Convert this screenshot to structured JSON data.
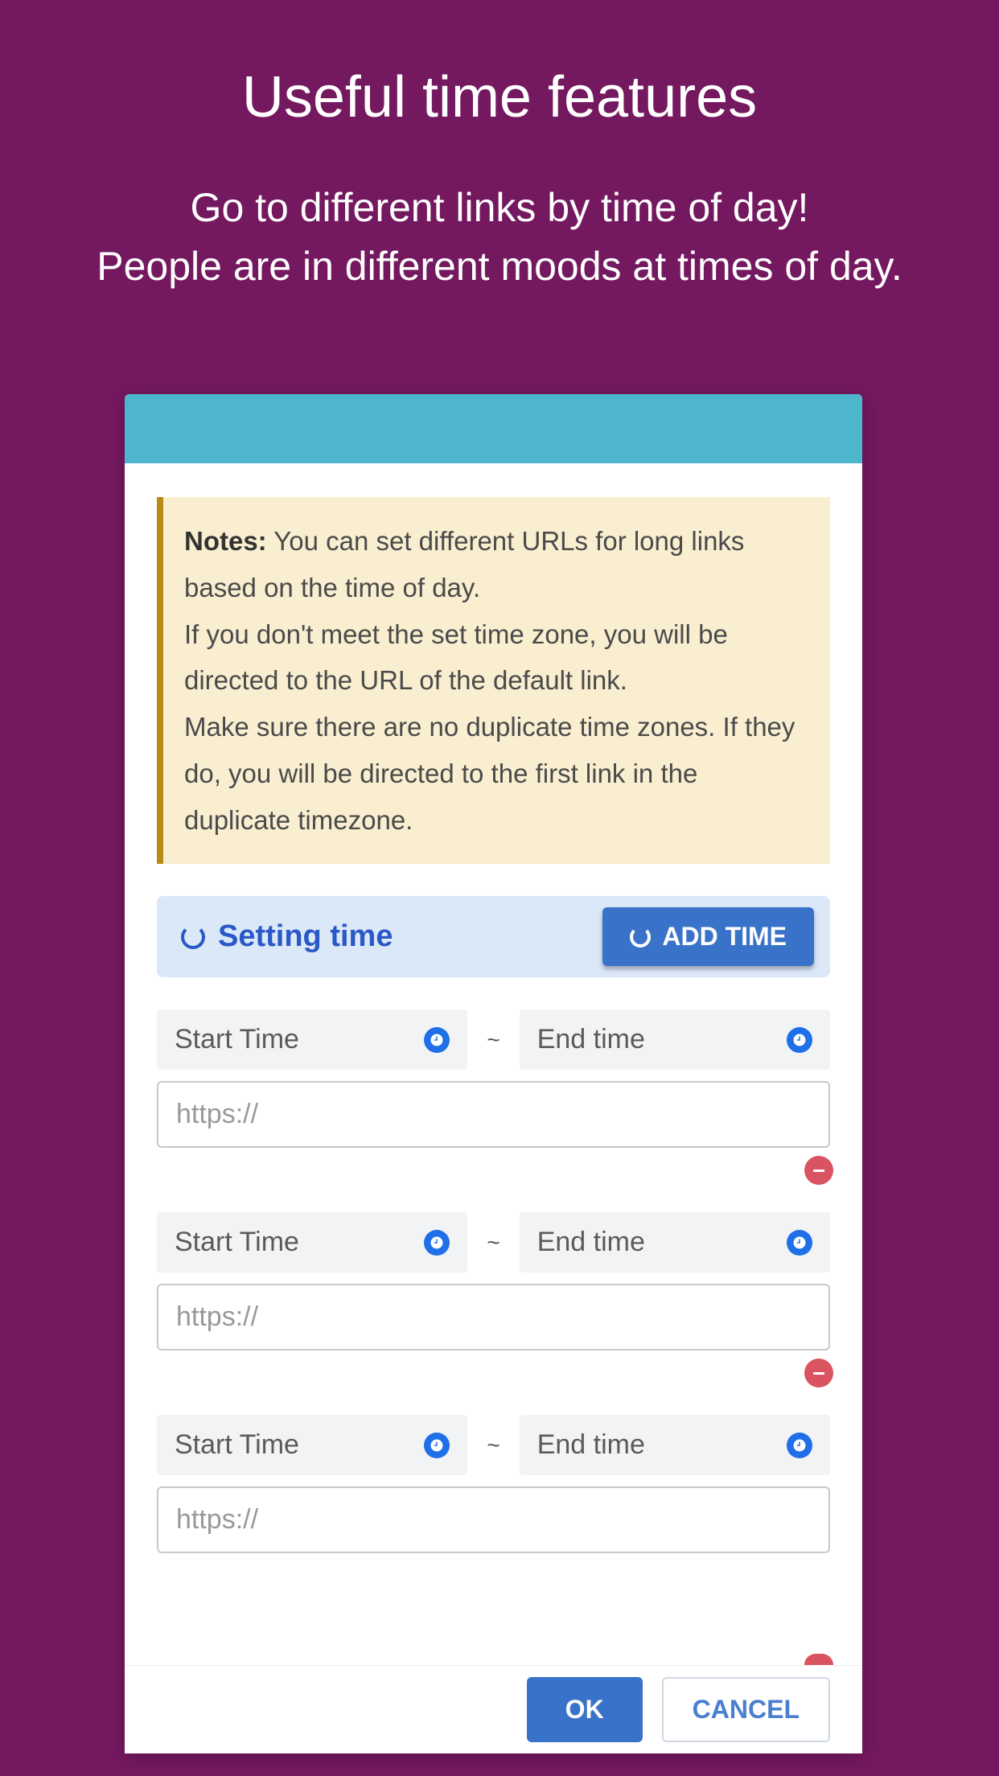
{
  "page": {
    "title": "Useful time features",
    "subtitle_line1": "Go to different links by time of day!",
    "subtitle_line2": "People are in different moods at times of day."
  },
  "notes": {
    "label": "Notes:",
    "text": " You can set different URLs for long links based on the time of day.\nIf you don't meet the set time zone, you will be directed to the URL of the default link.\nMake sure there are no duplicate time zones. If they do, you will be directed to the first link in the duplicate timezone."
  },
  "section": {
    "title": "Setting time",
    "add_button": "ADD TIME"
  },
  "entries": [
    {
      "start_label": "Start Time",
      "end_label": "End time",
      "url_placeholder": "https://"
    },
    {
      "start_label": "Start Time",
      "end_label": "End time",
      "url_placeholder": "https://"
    },
    {
      "start_label": "Start Time",
      "end_label": "End time",
      "url_placeholder": "https://"
    }
  ],
  "footer": {
    "ok": "OK",
    "cancel": "CANCEL"
  },
  "separator": "~",
  "colors": {
    "background": "#74185f",
    "header_bar": "#4db6cc",
    "accent_blue": "#3973c9",
    "note_bg": "#f9eed0",
    "note_border": "#b88a1a"
  }
}
